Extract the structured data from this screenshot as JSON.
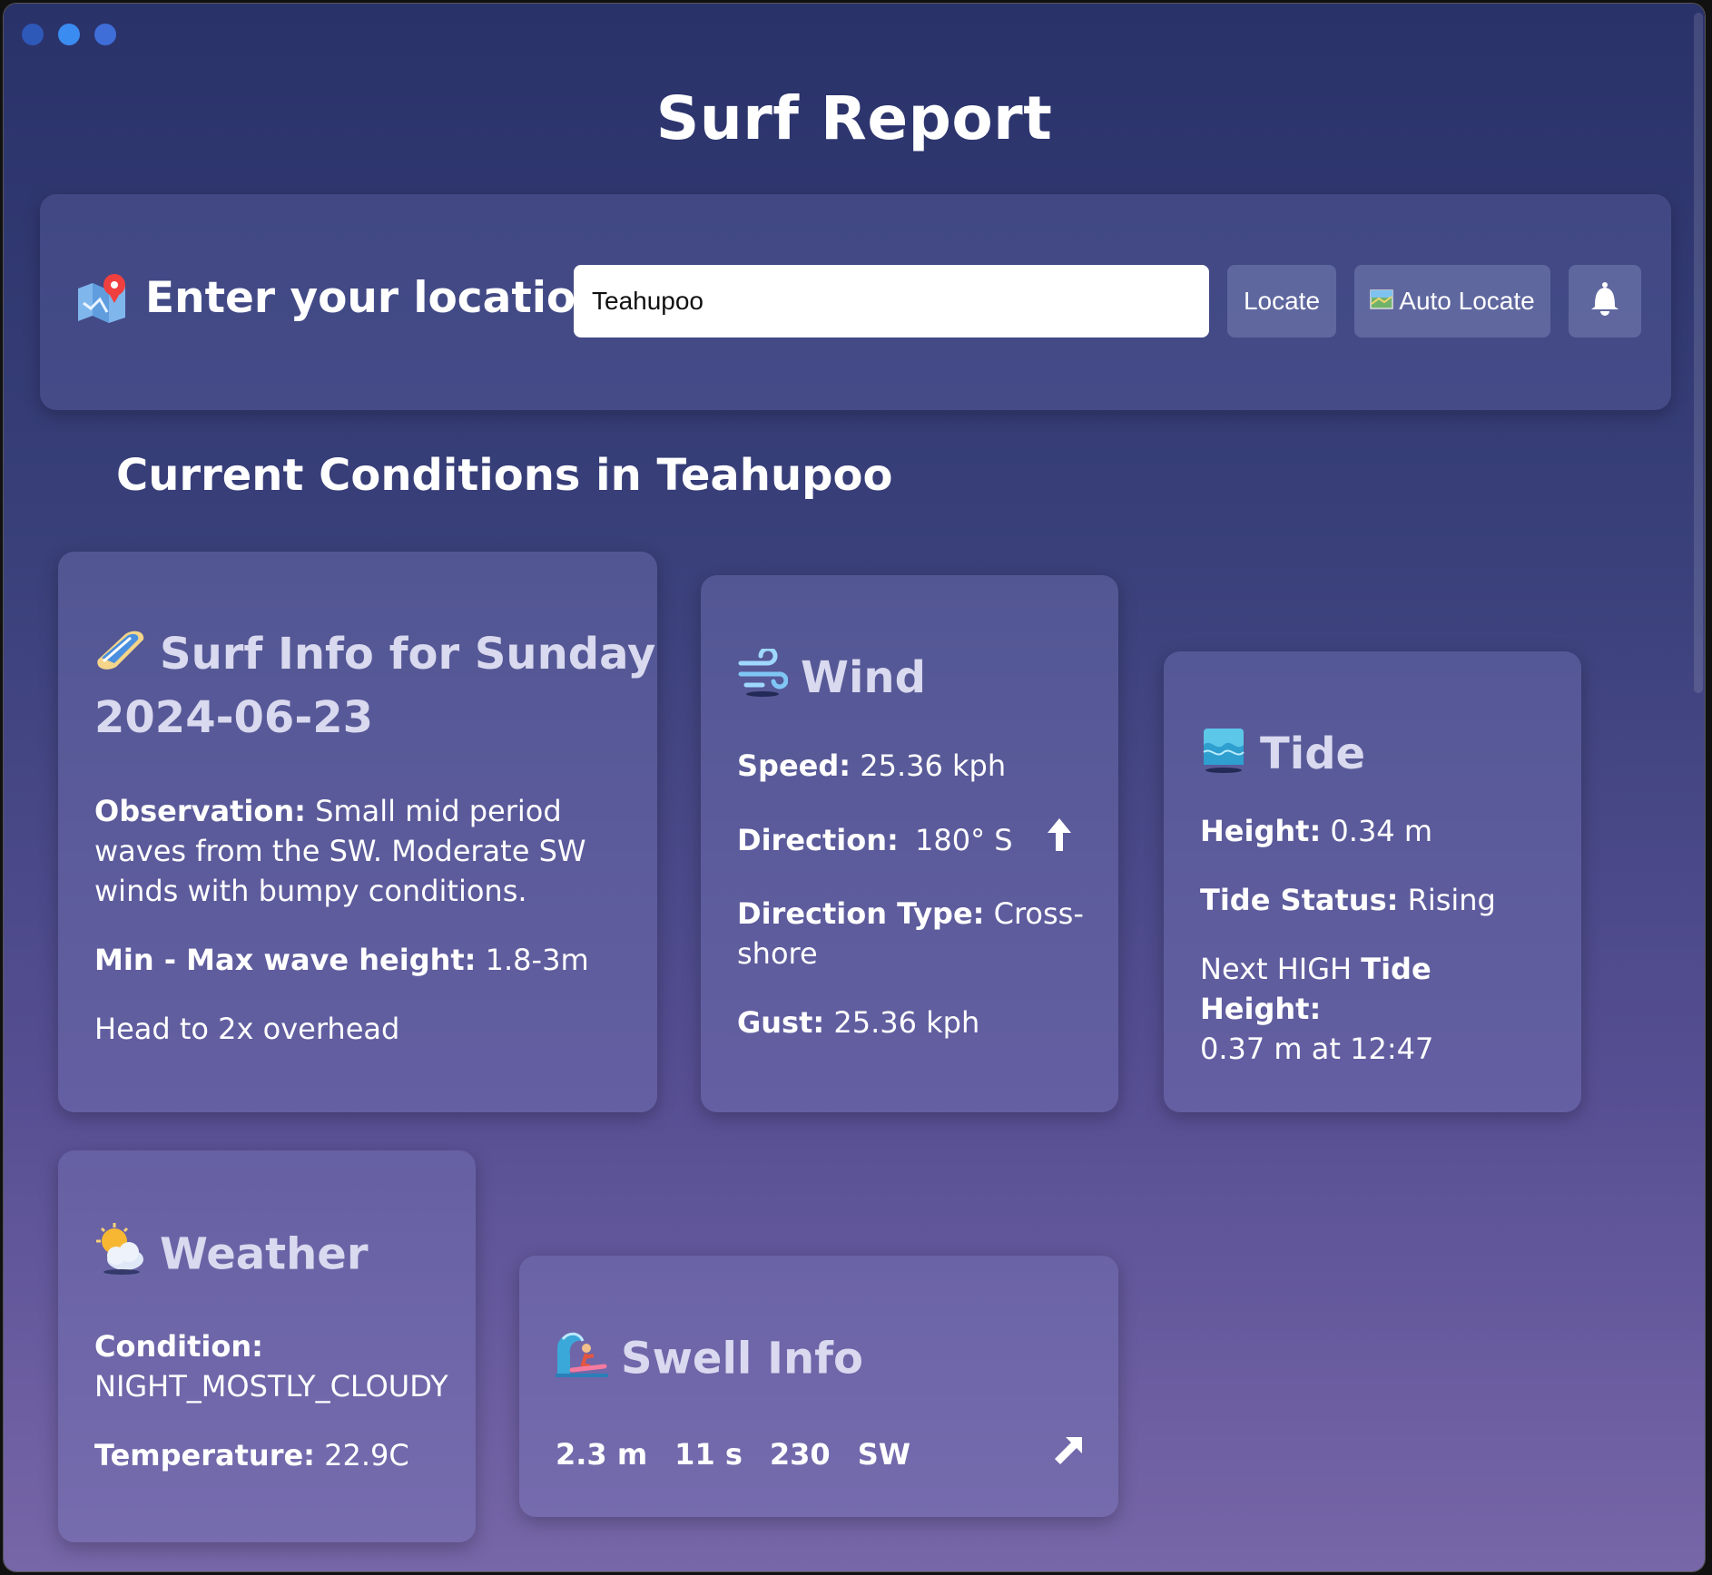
{
  "app": {
    "title": "Surf Report"
  },
  "location": {
    "label": "Enter your location",
    "input_value": "Teahupoo",
    "locate_label": "Locate",
    "auto_locate_label": "Auto Locate"
  },
  "section": {
    "heading": "Current Conditions in Teahupoo"
  },
  "surf": {
    "title_line1": "Surf Info for Sunday",
    "title_line2": "2024-06-23",
    "observation_label": "Observation:",
    "observation_text": " Small mid period waves from the SW. Moderate SW winds with bumpy conditions.",
    "wave_label": "Min - Max wave height:",
    "wave_value": " 1.8-3m",
    "description": "Head to 2x overhead"
  },
  "wind": {
    "title": "Wind",
    "speed_label": "Speed:",
    "speed_value": " 25.36 kph",
    "direction_label": "Direction:",
    "direction_value": "180° S",
    "direction_type_label": "Direction Type:",
    "direction_type_value": " Cross-shore",
    "gust_label": "Gust:",
    "gust_value": " 25.36 kph"
  },
  "tide": {
    "title": "Tide",
    "height_label": "Height:",
    "height_value": " 0.34 m",
    "status_label": "Tide Status:",
    "status_value": " Rising",
    "next_prefix": "Next HIGH ",
    "next_label": "Tide Height:",
    "next_value": "0.37 m at 12:47"
  },
  "weather": {
    "title": "Weather",
    "condition_label": "Condition:",
    "condition_value": "NIGHT_MOSTLY_CLOUDY",
    "temperature_label": "Temperature:",
    "temperature_value": " 22.9C"
  },
  "swell": {
    "title": "Swell Info",
    "height": "2.3 m",
    "period": "11 s",
    "direction_deg": "230",
    "direction": "SW"
  },
  "icons": {
    "map": "map-pin-icon",
    "surf": "surfboard-icon",
    "wind": "wind-icon",
    "tide": "water-wave-icon",
    "weather": "sun-behind-cloud-icon",
    "swell": "surfer-icon",
    "bell": "bell-icon",
    "wind_arrow": "arrow-up-icon",
    "swell_arrow": "arrow-up-right-icon"
  }
}
